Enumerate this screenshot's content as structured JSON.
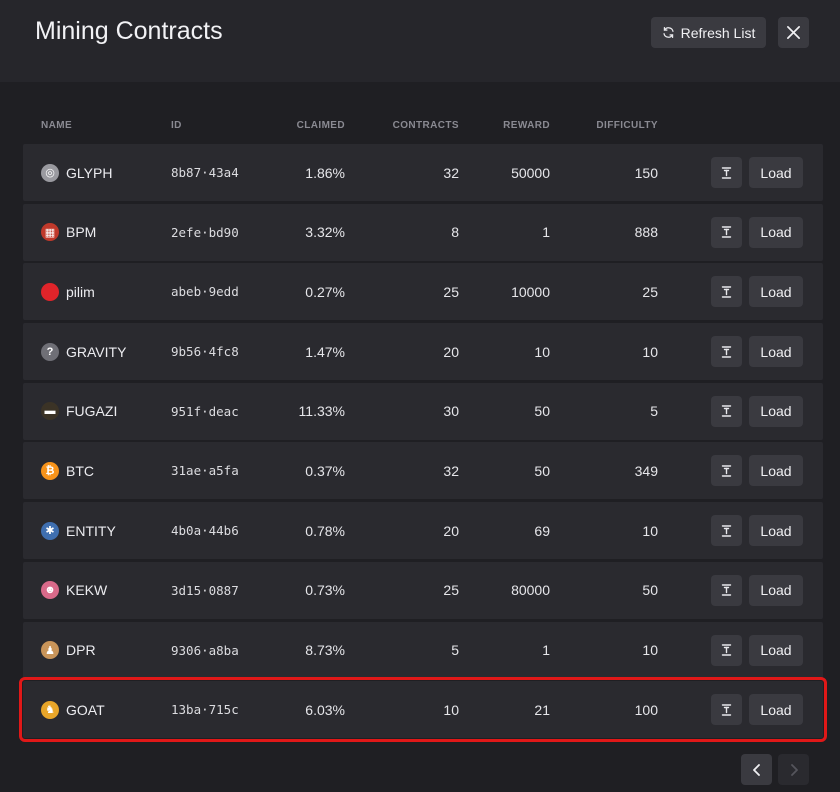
{
  "header": {
    "title": "Mining Contracts",
    "refresh_label": "Refresh List"
  },
  "columns": {
    "name": "NAME",
    "id": "ID",
    "claimed": "CLAIMED",
    "contracts": "CONTRACTS",
    "reward": "REWARD",
    "difficulty": "DIFFICULTY"
  },
  "load_label": "Load",
  "rows": [
    {
      "name": "GLYPH",
      "id": "8b87·43a4",
      "claimed": "1.86%",
      "contracts": "32",
      "reward": "50000",
      "difficulty": "150",
      "icon": "glyph-icon",
      "icon_color": "#9a9aa0"
    },
    {
      "name": "BPM",
      "id": "2efe·bd90",
      "claimed": "3.32%",
      "contracts": "8",
      "reward": "1",
      "difficulty": "888",
      "icon": "bpm-icon",
      "icon_color": "#c0392b"
    },
    {
      "name": "pilim",
      "id": "abeb·9edd",
      "claimed": "0.27%",
      "contracts": "25",
      "reward": "10000",
      "difficulty": "25",
      "icon": "red-ball-icon",
      "icon_color": "#e0242a"
    },
    {
      "name": "GRAVITY",
      "id": "9b56·4fc8",
      "claimed": "1.47%",
      "contracts": "20",
      "reward": "10",
      "difficulty": "10",
      "icon": "question-icon",
      "icon_color": "#6f6f76"
    },
    {
      "name": "FUGAZI",
      "id": "951f·deac",
      "claimed": "11.33%",
      "contracts": "30",
      "reward": "50",
      "difficulty": "5",
      "icon": "fugazi-icon",
      "icon_color": "#3b3326"
    },
    {
      "name": "BTC",
      "id": "31ae·a5fa",
      "claimed": "0.37%",
      "contracts": "32",
      "reward": "50",
      "difficulty": "349",
      "icon": "bitcoin-icon",
      "icon_color": "#f7931a"
    },
    {
      "name": "ENTITY",
      "id": "4b0a·44b6",
      "claimed": "0.78%",
      "contracts": "20",
      "reward": "69",
      "difficulty": "10",
      "icon": "entity-icon",
      "icon_color": "#3f6fb0"
    },
    {
      "name": "KEKW",
      "id": "3d15·0887",
      "claimed": "0.73%",
      "contracts": "25",
      "reward": "80000",
      "difficulty": "50",
      "icon": "kekw-icon",
      "icon_color": "#d96a8a"
    },
    {
      "name": "DPR",
      "id": "9306·a8ba",
      "claimed": "8.73%",
      "contracts": "5",
      "reward": "1",
      "difficulty": "10",
      "icon": "dpr-icon",
      "icon_color": "#c9955a"
    },
    {
      "name": "GOAT",
      "id": "13ba·715c",
      "claimed": "6.03%",
      "contracts": "10",
      "reward": "21",
      "difficulty": "100",
      "icon": "goat-icon",
      "icon_color": "#e8a62a",
      "selected": true
    }
  ]
}
